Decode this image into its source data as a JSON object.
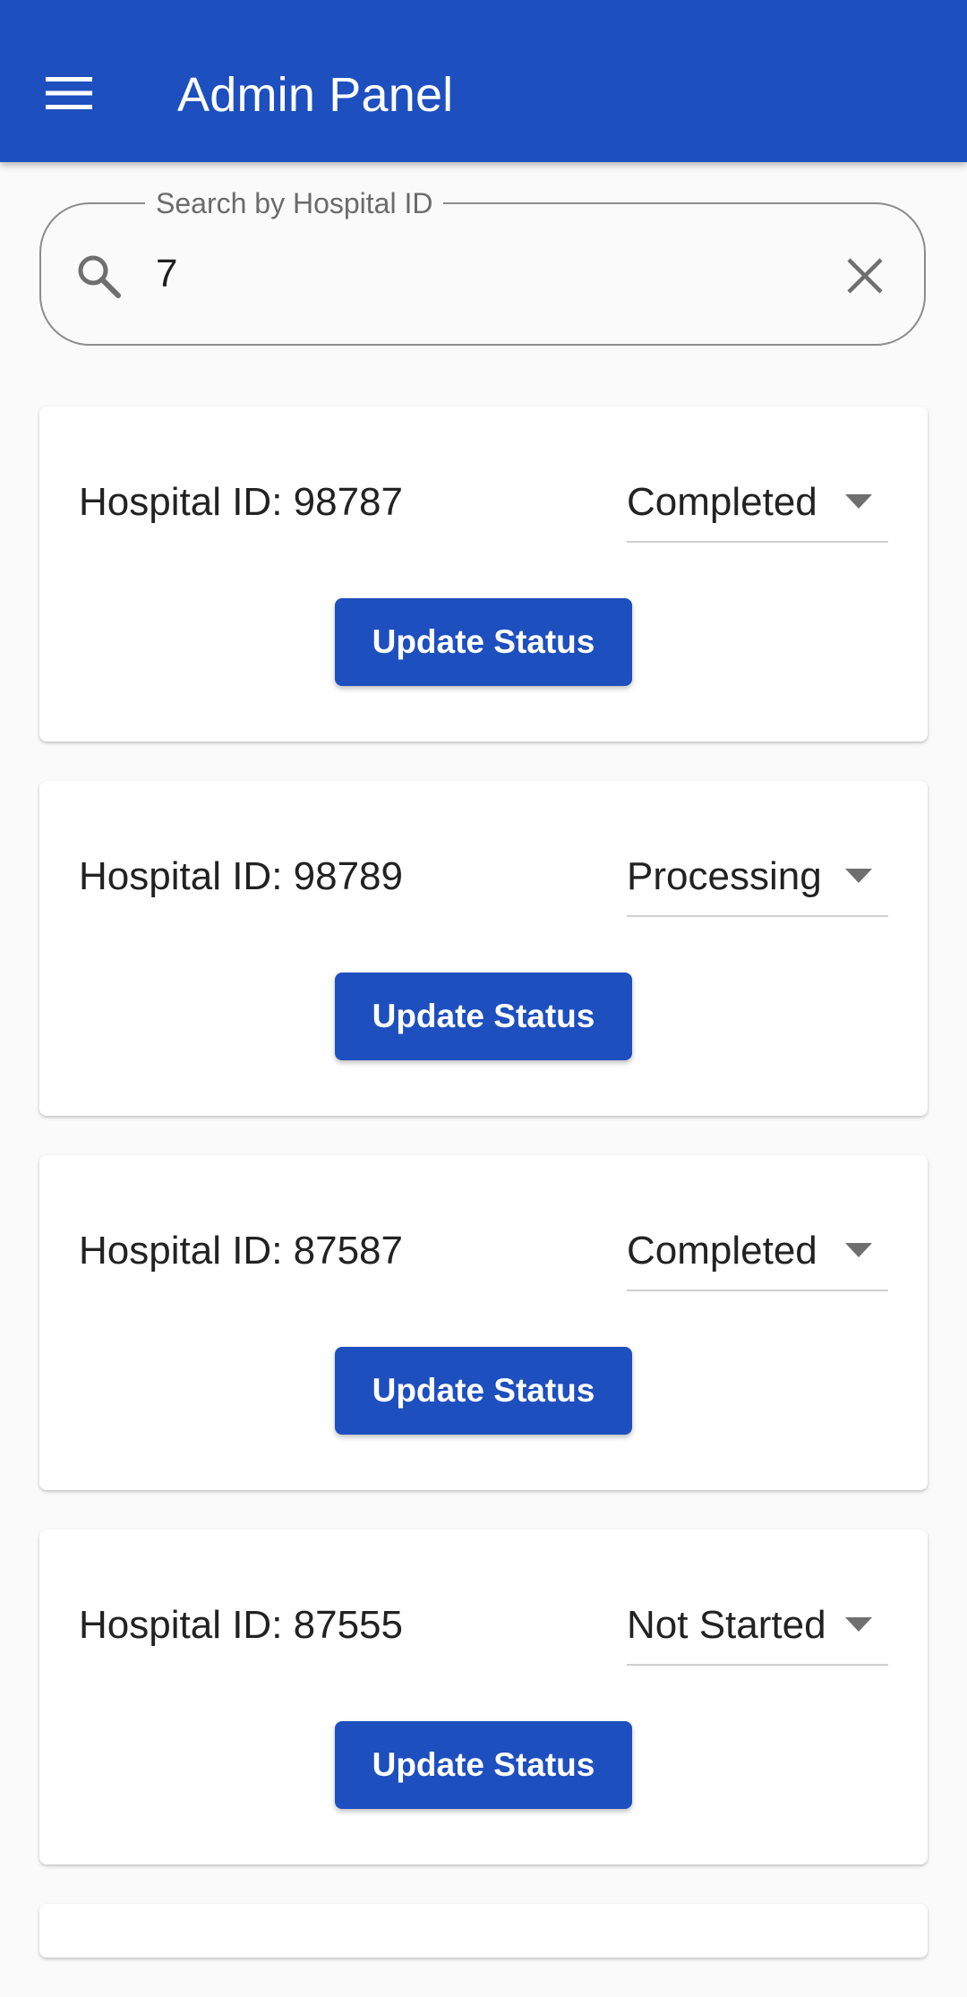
{
  "app_bar": {
    "title": "Admin Panel",
    "menu_icon": "hamburger-menu-icon",
    "color": "#1e4fbf"
  },
  "search": {
    "label": "Search by Hospital ID",
    "value": "7",
    "search_icon": "search-icon",
    "clear_icon": "close-icon"
  },
  "hospitals": [
    {
      "id_text": "Hospital ID: 98787",
      "status": "Completed",
      "button_label": "Update Status"
    },
    {
      "id_text": "Hospital ID: 98789",
      "status": "Processing",
      "button_label": "Update Status"
    },
    {
      "id_text": "Hospital ID: 87587",
      "status": "Completed",
      "button_label": "Update Status"
    },
    {
      "id_text": "Hospital ID: 87555",
      "status": "Not Started",
      "button_label": "Update Status"
    }
  ]
}
